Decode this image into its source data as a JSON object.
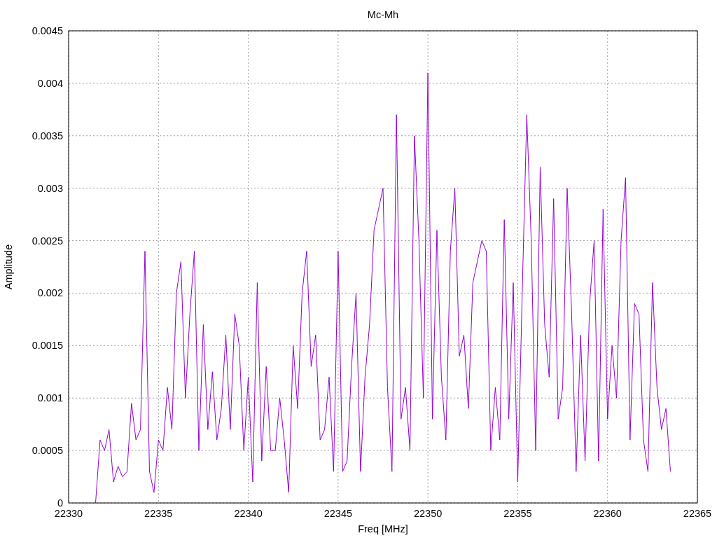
{
  "chart_data": {
    "type": "line",
    "grid": true,
    "title": "Mc-Mh",
    "xlabel": "Freq [MHz]",
    "ylabel": "Amplitude",
    "xlim": [
      22330,
      22365
    ],
    "ylim": [
      0,
      0.0045
    ],
    "xticks": [
      22330,
      22335,
      22340,
      22345,
      22350,
      22355,
      22360,
      22365
    ],
    "yticks": [
      0,
      0.0005,
      0.001,
      0.0015,
      0.002,
      0.0025,
      0.003,
      0.0035,
      0.004,
      0.0045
    ],
    "x": [
      22331.5,
      22331.75,
      22332,
      22332.25,
      22332.5,
      22332.75,
      22333,
      22333.25,
      22333.5,
      22333.75,
      22334,
      22334.25,
      22334.5,
      22334.75,
      22335,
      22335.25,
      22335.5,
      22335.75,
      22336,
      22336.25,
      22336.5,
      22336.75,
      22337,
      22337.25,
      22337.5,
      22337.75,
      22338,
      22338.25,
      22338.5,
      22338.75,
      22339,
      22339.25,
      22339.5,
      22339.75,
      22340,
      22340.25,
      22340.5,
      22340.75,
      22341,
      22341.25,
      22341.5,
      22341.75,
      22342,
      22342.25,
      22342.5,
      22342.75,
      22343,
      22343.25,
      22343.5,
      22343.75,
      22344,
      22344.25,
      22344.5,
      22344.75,
      22345,
      22345.25,
      22345.5,
      22345.75,
      22346,
      22346.25,
      22346.5,
      22346.75,
      22347,
      22347.25,
      22347.5,
      22347.75,
      22348,
      22348.25,
      22348.5,
      22348.75,
      22349,
      22349.25,
      22349.5,
      22349.75,
      22350,
      22350.25,
      22350.5,
      22350.75,
      22351,
      22351.25,
      22351.5,
      22351.75,
      22352,
      22352.25,
      22352.5,
      22352.75,
      22353,
      22353.25,
      22353.5,
      22353.75,
      22354,
      22354.25,
      22354.5,
      22354.75,
      22355,
      22355.25,
      22355.5,
      22355.75,
      22356,
      22356.25,
      22356.5,
      22356.75,
      22357,
      22357.25,
      22357.5,
      22357.75,
      22358,
      22358.25,
      22358.5,
      22358.75,
      22359,
      22359.25,
      22359.5,
      22359.75,
      22360,
      22360.25,
      22360.5,
      22360.75,
      22361,
      22361.25,
      22361.5,
      22361.75,
      22362,
      22362.25,
      22362.5,
      22362.75,
      22363,
      22363.25,
      22363.5
    ],
    "series": [
      {
        "color": "#9400d3",
        "values": [
          0,
          0.0006,
          0.0005,
          0.0007,
          0.0002,
          0.00035,
          0.00025,
          0.0003,
          0.00095,
          0.0006,
          0.0007,
          0.0024,
          0.0003,
          0.0001,
          0.0006,
          0.0005,
          0.0011,
          0.0007,
          0.002,
          0.0023,
          0.001,
          0.0018,
          0.0024,
          0.0005,
          0.0017,
          0.0007,
          0.00125,
          0.0006,
          0.0009,
          0.0016,
          0.0007,
          0.0018,
          0.0015,
          0.0005,
          0.0012,
          0.0002,
          0.0021,
          0.0004,
          0.0013,
          0.0005,
          0.0005,
          0.001,
          0.0006,
          0.0001,
          0.0015,
          0.0009,
          0.002,
          0.0024,
          0.0013,
          0.0016,
          0.0006,
          0.0007,
          0.0012,
          0.0003,
          0.0024,
          0.0003,
          0.0004,
          0.0013,
          0.002,
          0.0003,
          0.0012,
          0.0017,
          0.0026,
          0.0028,
          0.003,
          0.0011,
          0.0003,
          0.0037,
          0.0008,
          0.0011,
          0.0005,
          0.0035,
          0.0025,
          0.001,
          0.0041,
          0.0008,
          0.0026,
          0.0012,
          0.0006,
          0.0024,
          0.003,
          0.0014,
          0.0016,
          0.0009,
          0.0021,
          0.0023,
          0.0025,
          0.0024,
          0.0005,
          0.0011,
          0.0006,
          0.0027,
          0.0008,
          0.0021,
          0.0002,
          0.002,
          0.0037,
          0.0025,
          0.0005,
          0.0032,
          0.0017,
          0.0012,
          0.0029,
          0.0008,
          0.0011,
          0.003,
          0.0018,
          0.0003,
          0.0016,
          0.0004,
          0.0019,
          0.0025,
          0.0004,
          0.0028,
          0.0008,
          0.0015,
          0.001,
          0.0025,
          0.0031,
          0.0006,
          0.0019,
          0.0018,
          0.0006,
          0.0003,
          0.0021,
          0.0011,
          0.0007,
          0.0009,
          0.0003
        ]
      }
    ]
  }
}
